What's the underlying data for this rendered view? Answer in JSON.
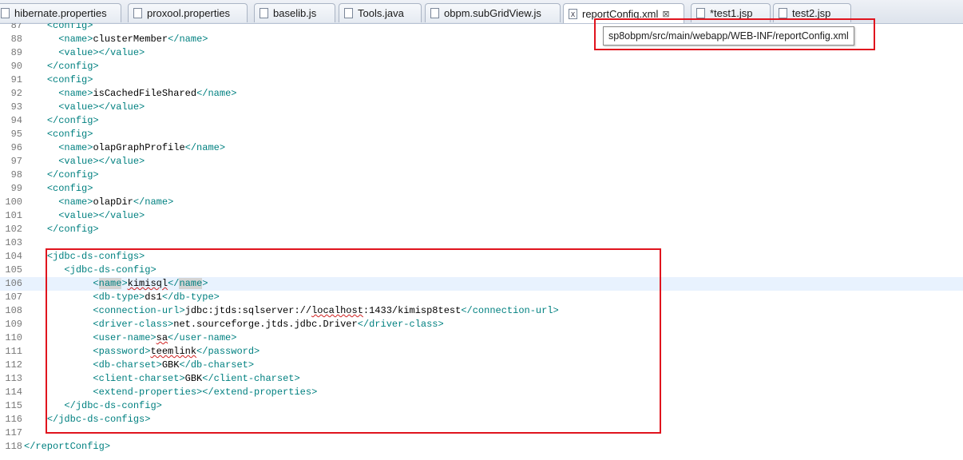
{
  "tabs": [
    {
      "label": "hibernate.properties",
      "icon": "properties-file-icon"
    },
    {
      "label": "proxool.properties",
      "icon": "properties-file-icon"
    },
    {
      "label": "baselib.js",
      "icon": "js-file-icon"
    },
    {
      "label": "Tools.java",
      "icon": "java-file-icon"
    },
    {
      "label": "obpm.subGridView.js",
      "icon": "js-file-icon"
    },
    {
      "label": "reportConfig.xml",
      "icon": "xml-file-icon",
      "active": true
    },
    {
      "label": "*test1.jsp",
      "icon": "jsp-file-icon"
    },
    {
      "label": "test2.jsp",
      "icon": "jsp-file-icon"
    }
  ],
  "tooltip": "sp8obpm/src/main/webapp/WEB-INF/reportConfig.xml",
  "colors": {
    "tag": "#008080",
    "text": "#000000",
    "highlight_box": "#e0141e",
    "current_line": "#e8f2fe"
  },
  "lines": [
    {
      "num": "87",
      "indent": "    ",
      "tokens": [
        {
          "t": "tag",
          "v": "<config>"
        }
      ]
    },
    {
      "num": "88",
      "indent": "      ",
      "tokens": [
        {
          "t": "tag",
          "v": "<name>"
        },
        {
          "t": "text",
          "v": "clusterMember"
        },
        {
          "t": "tag",
          "v": "</name>"
        }
      ]
    },
    {
      "num": "89",
      "indent": "      ",
      "tokens": [
        {
          "t": "tag",
          "v": "<value></value>"
        }
      ]
    },
    {
      "num": "90",
      "indent": "    ",
      "tokens": [
        {
          "t": "tag",
          "v": "</config>"
        }
      ]
    },
    {
      "num": "91",
      "indent": "    ",
      "tokens": [
        {
          "t": "tag",
          "v": "<config>"
        }
      ]
    },
    {
      "num": "92",
      "indent": "      ",
      "tokens": [
        {
          "t": "tag",
          "v": "<name>"
        },
        {
          "t": "text",
          "v": "isCachedFileShared"
        },
        {
          "t": "tag",
          "v": "</name>"
        }
      ]
    },
    {
      "num": "93",
      "indent": "      ",
      "tokens": [
        {
          "t": "tag",
          "v": "<value></value>"
        }
      ]
    },
    {
      "num": "94",
      "indent": "    ",
      "tokens": [
        {
          "t": "tag",
          "v": "</config>"
        }
      ]
    },
    {
      "num": "95",
      "indent": "    ",
      "tokens": [
        {
          "t": "tag",
          "v": "<config>"
        }
      ]
    },
    {
      "num": "96",
      "indent": "      ",
      "tokens": [
        {
          "t": "tag",
          "v": "<name>"
        },
        {
          "t": "text",
          "v": "olapGraphProfile"
        },
        {
          "t": "tag",
          "v": "</name>"
        }
      ]
    },
    {
      "num": "97",
      "indent": "      ",
      "tokens": [
        {
          "t": "tag",
          "v": "<value></value>"
        }
      ]
    },
    {
      "num": "98",
      "indent": "    ",
      "tokens": [
        {
          "t": "tag",
          "v": "</config>"
        }
      ]
    },
    {
      "num": "99",
      "indent": "    ",
      "tokens": [
        {
          "t": "tag",
          "v": "<config>"
        }
      ]
    },
    {
      "num": "100",
      "indent": "      ",
      "tokens": [
        {
          "t": "tag",
          "v": "<name>"
        },
        {
          "t": "text",
          "v": "olapDir"
        },
        {
          "t": "tag",
          "v": "</name>"
        }
      ]
    },
    {
      "num": "101",
      "indent": "      ",
      "tokens": [
        {
          "t": "tag",
          "v": "<value></value>"
        }
      ]
    },
    {
      "num": "102",
      "indent": "    ",
      "tokens": [
        {
          "t": "tag",
          "v": "</config>"
        }
      ]
    },
    {
      "num": "103",
      "indent": "",
      "tokens": []
    },
    {
      "num": "104",
      "indent": "    ",
      "tokens": [
        {
          "t": "tag",
          "v": "<jdbc-ds-configs>"
        }
      ]
    },
    {
      "num": "105",
      "indent": "       ",
      "tokens": [
        {
          "t": "tag",
          "v": "<jdbc-ds-config>"
        }
      ]
    },
    {
      "num": "106",
      "indent": "            ",
      "current": true,
      "tokens": [
        {
          "t": "tag",
          "v": "<"
        },
        {
          "t": "tag",
          "v": "name",
          "hl": true
        },
        {
          "t": "tag",
          "v": ">"
        },
        {
          "t": "text",
          "v": "kimisql",
          "ul": true
        },
        {
          "t": "tag",
          "v": "</"
        },
        {
          "t": "tag",
          "v": "name",
          "hl": true
        },
        {
          "t": "tag",
          "v": ">"
        }
      ]
    },
    {
      "num": "107",
      "indent": "            ",
      "tokens": [
        {
          "t": "tag",
          "v": "<db-type>"
        },
        {
          "t": "text",
          "v": "ds1"
        },
        {
          "t": "tag",
          "v": "</db-type>"
        }
      ]
    },
    {
      "num": "108",
      "indent": "            ",
      "tokens": [
        {
          "t": "tag",
          "v": "<connection-url>"
        },
        {
          "t": "text",
          "v": "jdbc:jtds:sqlserver://"
        },
        {
          "t": "text",
          "v": "localhost",
          "ul": true
        },
        {
          "t": "text",
          "v": ":1433/kimisp8test"
        },
        {
          "t": "tag",
          "v": "</connection-url>"
        }
      ]
    },
    {
      "num": "109",
      "indent": "            ",
      "tokens": [
        {
          "t": "tag",
          "v": "<driver-class>"
        },
        {
          "t": "text",
          "v": "net.sourceforge.jtds.jdbc.Driver"
        },
        {
          "t": "tag",
          "v": "</driver-class>"
        }
      ]
    },
    {
      "num": "110",
      "indent": "            ",
      "tokens": [
        {
          "t": "tag",
          "v": "<user-name>"
        },
        {
          "t": "text",
          "v": "sa",
          "ul": true
        },
        {
          "t": "tag",
          "v": "</user-name>"
        }
      ]
    },
    {
      "num": "111",
      "indent": "            ",
      "tokens": [
        {
          "t": "tag",
          "v": "<password>"
        },
        {
          "t": "text",
          "v": "teemlink",
          "ul": true
        },
        {
          "t": "tag",
          "v": "</password>"
        }
      ]
    },
    {
      "num": "112",
      "indent": "            ",
      "tokens": [
        {
          "t": "tag",
          "v": "<db-charset>"
        },
        {
          "t": "text",
          "v": "GBK"
        },
        {
          "t": "tag",
          "v": "</db-charset>"
        }
      ]
    },
    {
      "num": "113",
      "indent": "            ",
      "tokens": [
        {
          "t": "tag",
          "v": "<client-charset>"
        },
        {
          "t": "text",
          "v": "GBK"
        },
        {
          "t": "tag",
          "v": "</client-charset>"
        }
      ]
    },
    {
      "num": "114",
      "indent": "            ",
      "tokens": [
        {
          "t": "tag",
          "v": "<extend-properties></extend-properties>"
        }
      ]
    },
    {
      "num": "115",
      "indent": "       ",
      "tokens": [
        {
          "t": "tag",
          "v": "</jdbc-ds-config>"
        }
      ]
    },
    {
      "num": "116",
      "indent": "    ",
      "tokens": [
        {
          "t": "tag",
          "v": "</jdbc-ds-configs>"
        }
      ]
    },
    {
      "num": "117",
      "indent": "",
      "tokens": []
    },
    {
      "num": "118",
      "indent": "",
      "tokens": [
        {
          "t": "tag",
          "v": "</reportConfig>"
        }
      ]
    }
  ]
}
